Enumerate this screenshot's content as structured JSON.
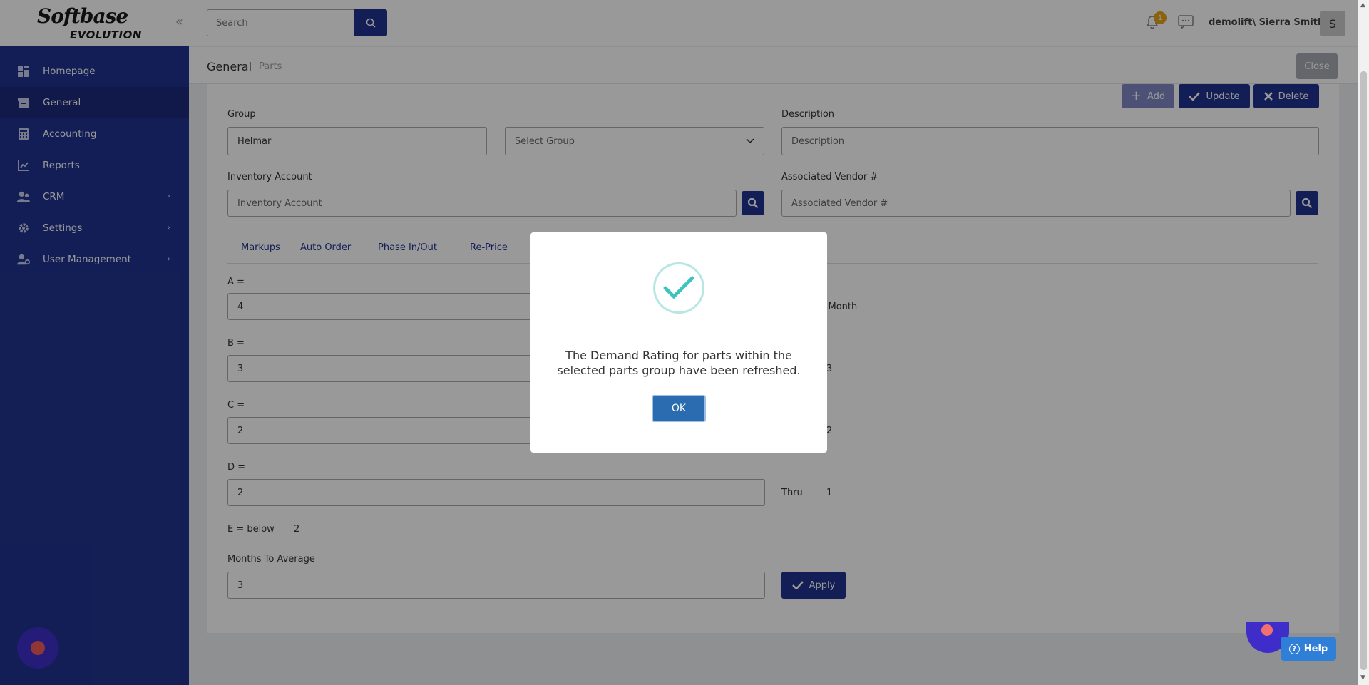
{
  "brand": {
    "line1": "Softbase",
    "line2": "EVOLUTION"
  },
  "sidebar": {
    "items": [
      {
        "label": "Homepage",
        "icon": "dashboard-icon"
      },
      {
        "label": "General",
        "icon": "archive-icon"
      },
      {
        "label": "Accounting",
        "icon": "calculator-icon"
      },
      {
        "label": "Reports",
        "icon": "chart-icon"
      },
      {
        "label": "CRM",
        "icon": "users-icon"
      },
      {
        "label": "Settings",
        "icon": "gear-icon"
      },
      {
        "label": "User Management",
        "icon": "user-cog-icon"
      }
    ]
  },
  "header": {
    "search_placeholder": "Search",
    "notification_count": "1",
    "user": "demolift\\ Sierra Smith",
    "avatar_initial": "S"
  },
  "breadcrumb": {
    "main": "General",
    "sub": "Parts",
    "close": "Close"
  },
  "actions": {
    "add": "Add",
    "update": "Update",
    "delete": "Delete"
  },
  "form": {
    "group_label": "Group",
    "group_value": "Helmar",
    "select_group": "Select Group",
    "description_label": "Description",
    "description_placeholder": "Description",
    "inventory_label": "Inventory Account",
    "inventory_placeholder": "Inventory Account",
    "vendor_label": "Associated Vendor #",
    "vendor_placeholder": "Associated Vendor #"
  },
  "tabs": [
    "Markups",
    "Auto Order",
    "Phase In/Out",
    "Re-Price"
  ],
  "ratings": {
    "a_label": "A =",
    "a_value": "4",
    "a_side": "r Month",
    "b_label": "B =",
    "b_value": "3",
    "b_side": "3",
    "c_label": "C =",
    "c_value": "2",
    "c_side": "2",
    "d_label": "D =",
    "d_value": "2",
    "d_thru": "Thru",
    "d_side": "1",
    "e_label": "E = below",
    "e_value": "2",
    "months_label": "Months To Average",
    "months_value": "3",
    "apply": "Apply"
  },
  "modal": {
    "message": "The Demand Rating for parts within the selected parts group have been refreshed.",
    "ok": "OK"
  },
  "help": {
    "label": "Help"
  },
  "colors": {
    "primary": "#22338f",
    "ok": "#2b6cb0",
    "check": "#3fc3be"
  }
}
